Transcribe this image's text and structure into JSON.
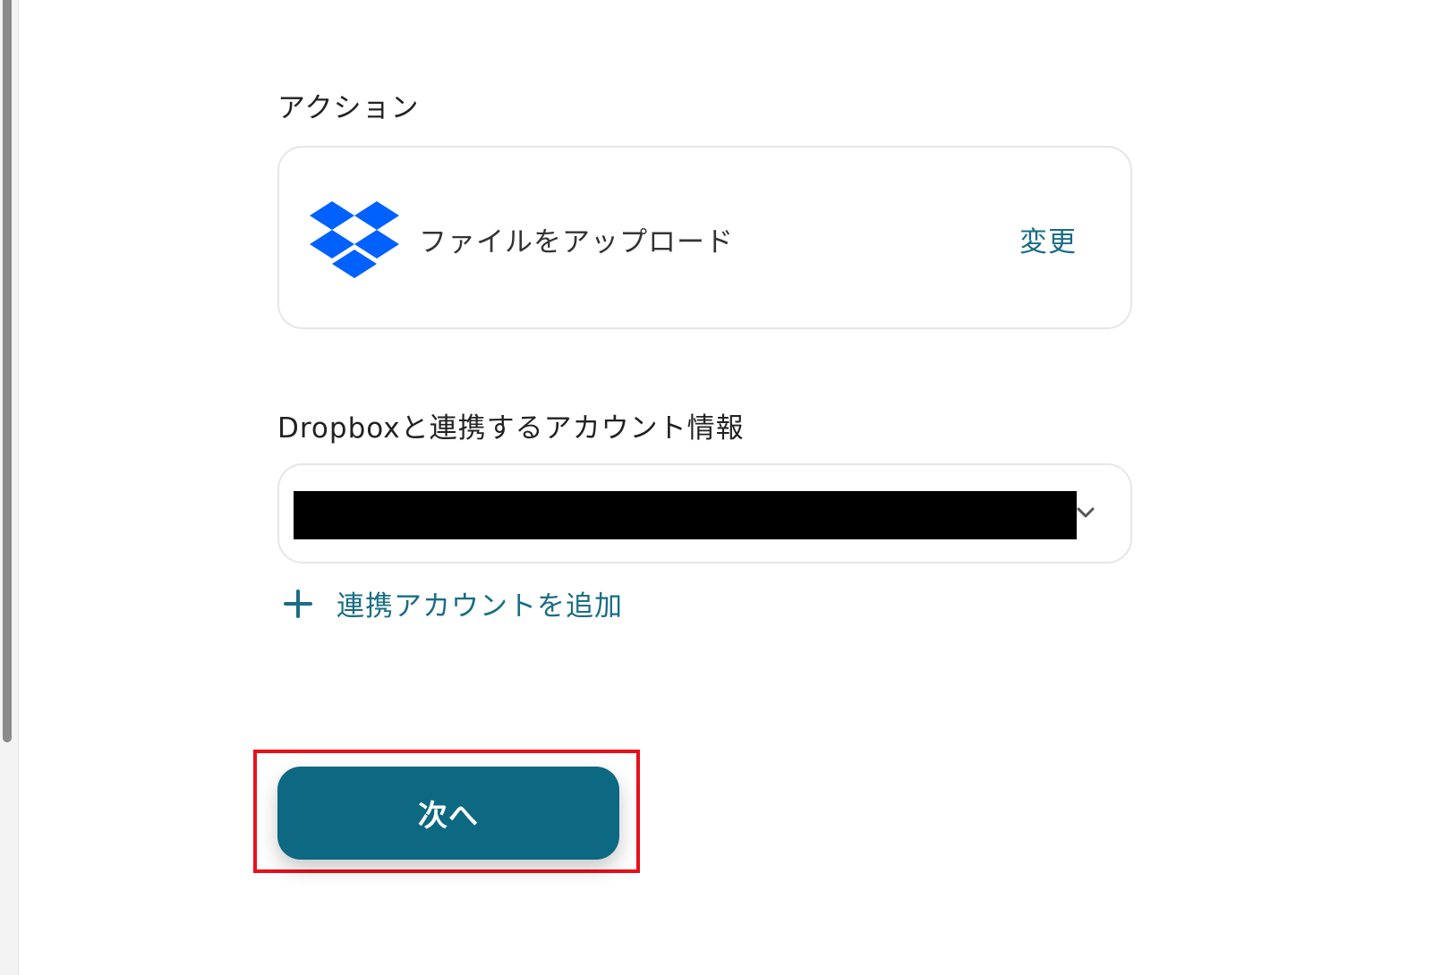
{
  "action_section": {
    "label": "アクション",
    "app_icon": "dropbox-icon",
    "action_name": "ファイルをアップロード",
    "change_label": "変更"
  },
  "account_section": {
    "label": "Dropboxと連携するアカウント情報",
    "add_account_label": "連携アカウントを追加"
  },
  "footer": {
    "next_label": "次へ"
  },
  "colors": {
    "accent": "#1a6d84",
    "button": "#0d6882",
    "dropbox": "#0061fe",
    "highlight": "#e8101b"
  }
}
